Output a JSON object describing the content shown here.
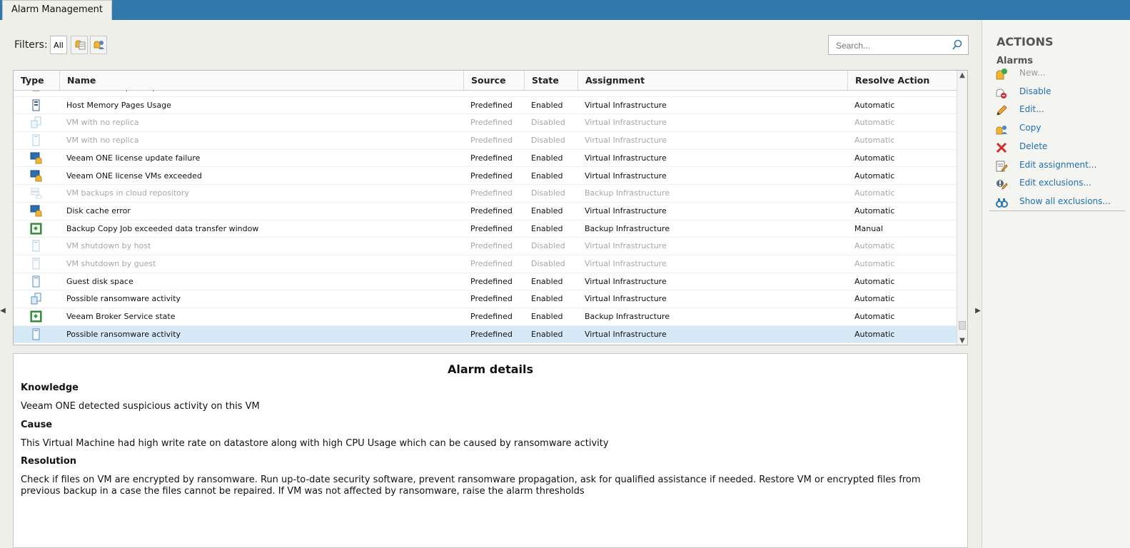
{
  "window": {
    "tab": "Alarm Management"
  },
  "filters": {
    "label": "Filters:",
    "all": "All",
    "icons": [
      "filter-alarms-icon",
      "filter-user-alarms-icon"
    ]
  },
  "search": {
    "placeholder": "Search..."
  },
  "table": {
    "columns": [
      "Type",
      "Name",
      "Source",
      "State",
      "Assignment",
      "Resolve Action"
    ],
    "partial_row": {
      "name": "Host CPU time per dispatch",
      "source": "Predefined",
      "state": "Enabled",
      "assignment": "Virtual Infrastructure",
      "resolve": "Automatic"
    },
    "rows": [
      {
        "icon": "server-icon",
        "name": "Host Memory Pages Usage",
        "source": "Predefined",
        "state": "Enabled",
        "assignment": "Virtual Infrastructure",
        "resolve": "Automatic",
        "disabled": false,
        "selected": false
      },
      {
        "icon": "vm-replica-icon",
        "name": "VM with no replica",
        "source": "Predefined",
        "state": "Disabled",
        "assignment": "Virtual Infrastructure",
        "resolve": "Automatic",
        "disabled": true,
        "selected": false
      },
      {
        "icon": "vm-icon",
        "name": "VM with no replica",
        "source": "Predefined",
        "state": "Disabled",
        "assignment": "Virtual Infrastructure",
        "resolve": "Automatic",
        "disabled": true,
        "selected": false
      },
      {
        "icon": "license-alarm-icon",
        "name": "Veeam ONE license update failure",
        "source": "Predefined",
        "state": "Enabled",
        "assignment": "Virtual Infrastructure",
        "resolve": "Automatic",
        "disabled": false,
        "selected": false
      },
      {
        "icon": "license-alarm-icon",
        "name": "Veeam ONE license VMs exceeded",
        "source": "Predefined",
        "state": "Enabled",
        "assignment": "Virtual Infrastructure",
        "resolve": "Automatic",
        "disabled": false,
        "selected": false
      },
      {
        "icon": "cloud-repository-icon",
        "name": "VM backups in cloud repository",
        "source": "Predefined",
        "state": "Disabled",
        "assignment": "Backup Infrastructure",
        "resolve": "Automatic",
        "disabled": true,
        "selected": false
      },
      {
        "icon": "license-alarm-icon",
        "name": "Disk cache error",
        "source": "Predefined",
        "state": "Enabled",
        "assignment": "Virtual Infrastructure",
        "resolve": "Automatic",
        "disabled": false,
        "selected": false
      },
      {
        "icon": "backup-job-icon",
        "name": "Backup Copy Job exceeded data transfer window",
        "source": "Predefined",
        "state": "Enabled",
        "assignment": "Backup Infrastructure",
        "resolve": "Manual",
        "disabled": false,
        "selected": false
      },
      {
        "icon": "vm-icon",
        "name": "VM shutdown by host",
        "source": "Predefined",
        "state": "Disabled",
        "assignment": "Virtual Infrastructure",
        "resolve": "Automatic",
        "disabled": true,
        "selected": false
      },
      {
        "icon": "vm-icon",
        "name": "VM shutdown by guest",
        "source": "Predefined",
        "state": "Disabled",
        "assignment": "Virtual Infrastructure",
        "resolve": "Automatic",
        "disabled": true,
        "selected": false
      },
      {
        "icon": "vm-icon",
        "name": "Guest disk space",
        "source": "Predefined",
        "state": "Enabled",
        "assignment": "Virtual Infrastructure",
        "resolve": "Automatic",
        "disabled": false,
        "selected": false
      },
      {
        "icon": "vm-replica-icon",
        "name": "Possible ransomware activity",
        "source": "Predefined",
        "state": "Enabled",
        "assignment": "Virtual Infrastructure",
        "resolve": "Automatic",
        "disabled": false,
        "selected": false
      },
      {
        "icon": "backup-job-icon",
        "name": "Veeam Broker Service state",
        "source": "Predefined",
        "state": "Enabled",
        "assignment": "Backup Infrastructure",
        "resolve": "Automatic",
        "disabled": false,
        "selected": false
      },
      {
        "icon": "vm-icon",
        "name": "Possible ransomware activity",
        "source": "Predefined",
        "state": "Enabled",
        "assignment": "Virtual Infrastructure",
        "resolve": "Automatic",
        "disabled": false,
        "selected": true
      }
    ]
  },
  "details": {
    "title": "Alarm details",
    "knowledge_label": "Knowledge",
    "knowledge": "Veeam ONE detected suspicious activity on this VM",
    "cause_label": "Cause",
    "cause": "This Virtual Machine had high write rate on datastore along with high CPU Usage which can be caused by ransomware activity",
    "resolution_label": "Resolution",
    "resolution_line1": "Check if files on VM are encrypted by ransomware. Run up-to-date security software, prevent ransomware propagation, ask for qualified assistance if needed. Restore VM or encrypted files from",
    "resolution_line2": "previous backup in a case the files cannot be repaired. If VM was not affected by ransomware, raise the alarm thresholds"
  },
  "actions": {
    "title": "ACTIONS",
    "subtitle": "Alarms",
    "items": [
      {
        "label": "New...",
        "icon": "new-alarm-icon",
        "disabled": true
      },
      {
        "label": "Disable",
        "icon": "disable-icon",
        "disabled": false
      },
      {
        "label": "Edit...",
        "icon": "edit-icon",
        "disabled": false
      },
      {
        "label": "Copy",
        "icon": "copy-icon",
        "disabled": false
      },
      {
        "label": "Delete",
        "icon": "delete-icon",
        "disabled": false
      },
      {
        "label": "Edit assignment...",
        "icon": "edit-assignment-icon",
        "disabled": false
      },
      {
        "label": "Edit exclusions...",
        "icon": "edit-exclusions-icon",
        "disabled": false
      },
      {
        "label": "Show all exclusions...",
        "icon": "show-exclusions-icon",
        "disabled": false
      }
    ]
  },
  "colors": {
    "accent": "#2f79ad",
    "selected_row": "#d6e9f7",
    "link": "#1f6fb2"
  }
}
